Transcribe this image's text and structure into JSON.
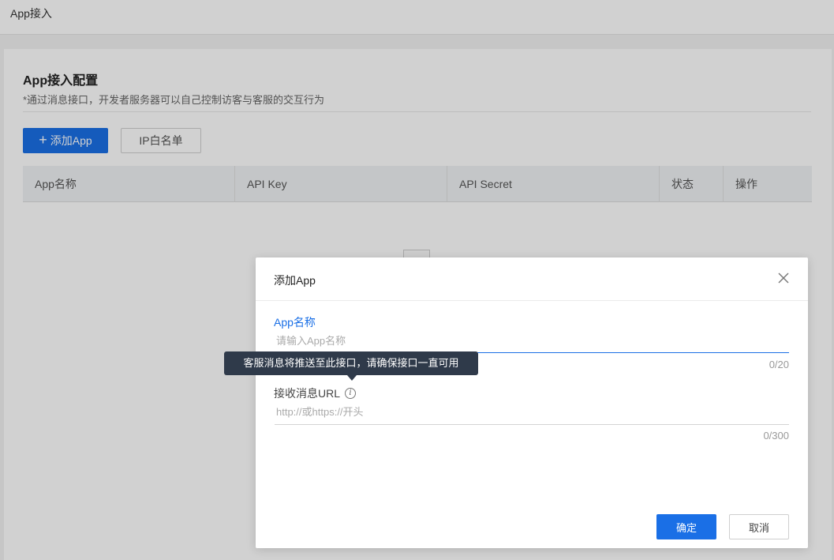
{
  "topbar": {
    "title": "App接入"
  },
  "panel": {
    "title": "App接入配置",
    "description": "*通过消息接口，开发者服务器可以自己控制访客与客服的交互行为",
    "add_button": {
      "icon": "plus-icon",
      "label": "添加App"
    },
    "whitelist_button": {
      "label": "IP白名单"
    }
  },
  "table": {
    "columns": [
      "App名称",
      "API Key",
      "API Secret",
      "状态",
      "操作"
    ]
  },
  "modal": {
    "title": "添加App",
    "close_icon": "close-icon",
    "app_name": {
      "label": "App名称",
      "placeholder": "请输入App名称",
      "value": "",
      "counter": "0/20"
    },
    "url": {
      "label": "接收消息URL",
      "info_icon": "info-icon",
      "placeholder": "http://或https://开头",
      "value": "",
      "counter": "0/300"
    },
    "confirm_label": "确定",
    "cancel_label": "取消"
  },
  "tooltip": {
    "text": "客服消息将推送至此接口，请确保接口一直可用"
  },
  "colors": {
    "primary": "#1a6fe6",
    "tooltip_bg": "#2f3a4a",
    "overlay": "rgba(0,0,0,0.18)"
  }
}
